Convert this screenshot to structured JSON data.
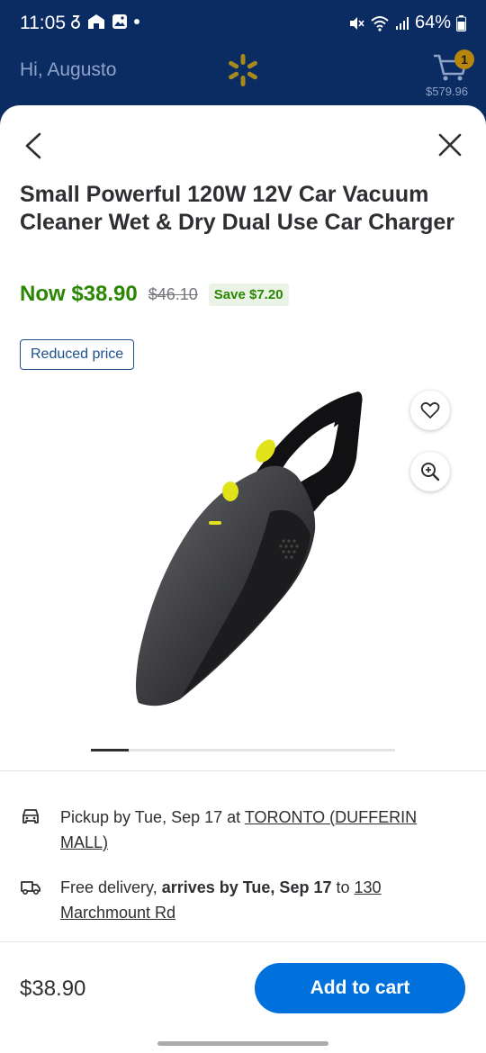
{
  "status_bar": {
    "time": "11:05",
    "battery": "64%"
  },
  "header": {
    "greeting": "Hi, Augusto",
    "cart_count": "1",
    "cart_total": "$579.96"
  },
  "product": {
    "title": "Small Powerful 120W 12V Car Vacuum Cleaner Wet & Dry Dual Use Car Charger",
    "now_price": "Now $38.90",
    "was_price": "$46.10",
    "save_badge": "Save $7.20",
    "tag": "Reduced price",
    "image_count_fraction": 0.125
  },
  "fulfillment": {
    "pickup_prefix": "Pickup by Tue, Sep 17 at ",
    "pickup_store": "TORONTO (DUFFERIN MALL)",
    "delivery_prefix": "Free delivery, ",
    "delivery_bold": "arrives by Tue, Sep 17",
    "delivery_mid": " to ",
    "delivery_address": "130 Marchmount Rd"
  },
  "footer": {
    "price": "$38.90",
    "add_to_cart": "Add to cart"
  },
  "colors": {
    "header_bg": "#0b2b63",
    "price_green": "#2a8703",
    "button_blue": "#0071dc",
    "spark_yellow": "#ffc220"
  }
}
